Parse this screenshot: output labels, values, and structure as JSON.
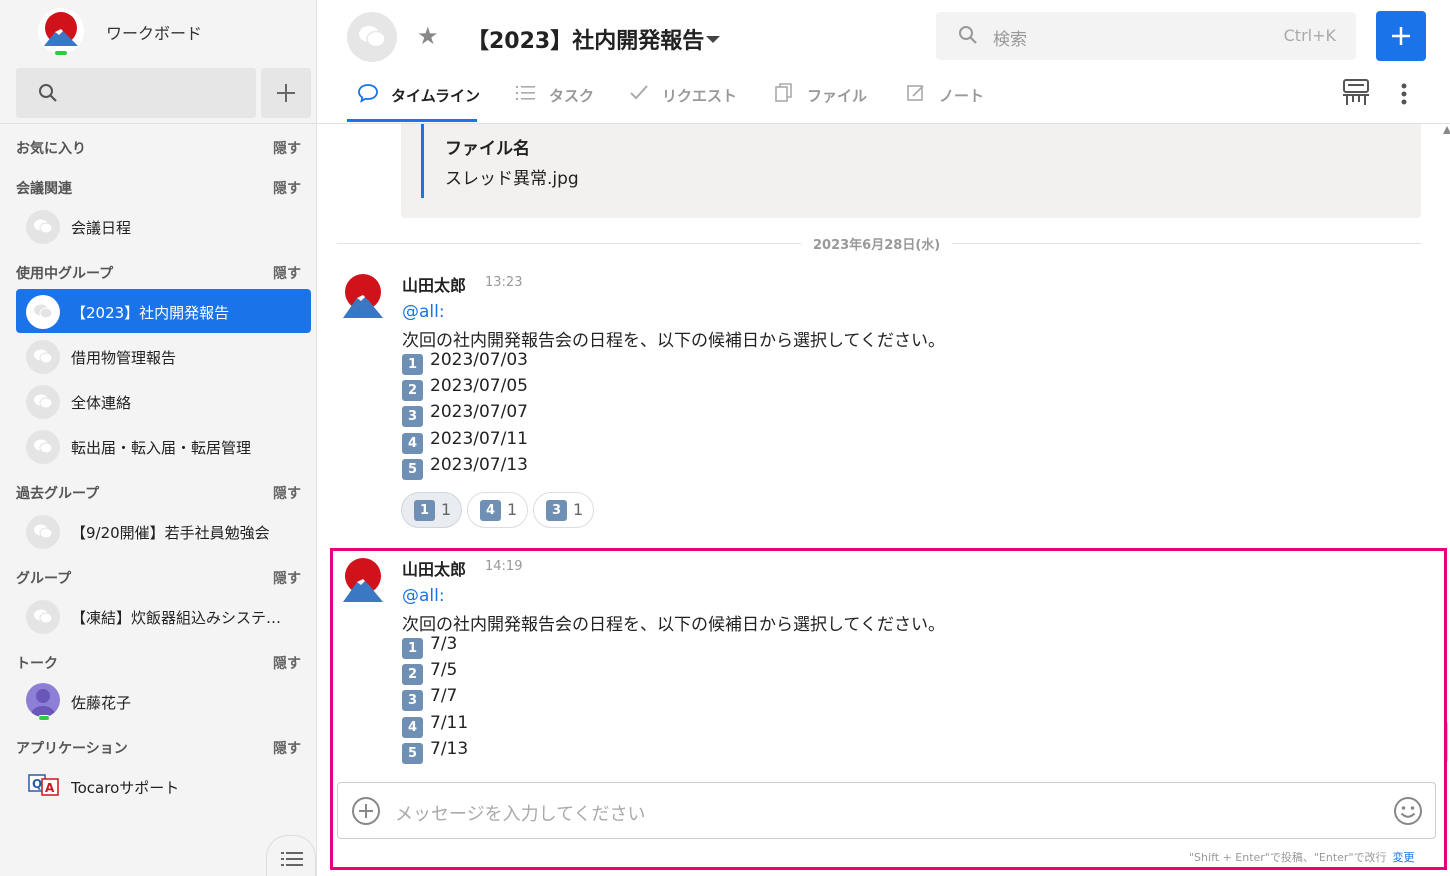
{
  "sidebar": {
    "workspace_name": "ワークボード",
    "sections": [
      {
        "title": "お気に入り",
        "hide": "隠す"
      },
      {
        "title": "会議関連",
        "hide": "隠す"
      },
      {
        "title": "使用中グループ",
        "hide": "隠す"
      },
      {
        "title": "過去グループ",
        "hide": "隠す"
      },
      {
        "title": "グループ",
        "hide": "隠す"
      },
      {
        "title": "トーク",
        "hide": "隠す"
      },
      {
        "title": "アプリケーション",
        "hide": "隠す"
      }
    ],
    "items": {
      "meeting_schedule": "会議日程",
      "dev_report": "【2023】社内開発報告",
      "loan_report": "借用物管理報告",
      "all_contact": "全体連絡",
      "moving_mgmt": "転出届・転入届・転居管理",
      "study_meeting": "【9/20開催】若手社員勉強会",
      "frozen_group": "【凍結】炊飯器組込みシステ…",
      "talk_user": "佐藤花子",
      "tocaro_support": "Tocaroサポート"
    }
  },
  "header": {
    "title": "【2023】社内開発報告",
    "search_placeholder": "検索",
    "search_shortcut": "Ctrl+K",
    "tabs": [
      {
        "label": "タイムライン",
        "icon": "chat-bubble-icon",
        "active": true
      },
      {
        "label": "タスク",
        "icon": "list-icon",
        "active": false
      },
      {
        "label": "リクエスト",
        "icon": "check-icon",
        "active": false
      },
      {
        "label": "ファイル",
        "icon": "file-copy-icon",
        "active": false
      },
      {
        "label": "ノート",
        "icon": "edit-note-icon",
        "active": false
      }
    ]
  },
  "timeline": {
    "file_block": {
      "key": "ファイル名",
      "value": "スレッド異常.jpg"
    },
    "date_separator": "2023年6月28日(水)",
    "messages": [
      {
        "author": "山田太郎",
        "time": "13:23",
        "mention": "@all:",
        "body": "次回の社内開発報告会の日程を、以下の候補日から選択してください。",
        "options": [
          {
            "num": "1",
            "text": "2023/07/03"
          },
          {
            "num": "2",
            "text": "2023/07/05"
          },
          {
            "num": "3",
            "text": "2023/07/07"
          },
          {
            "num": "4",
            "text": "2023/07/11"
          },
          {
            "num": "5",
            "text": "2023/07/13"
          }
        ],
        "reactions": [
          {
            "num": "1",
            "count": "1"
          },
          {
            "num": "4",
            "count": "1"
          },
          {
            "num": "3",
            "count": "1"
          }
        ]
      },
      {
        "author": "山田太郎",
        "time": "14:19",
        "mention": "@all:",
        "body": "次回の社内開発報告会の日程を、以下の候補日から選択してください。",
        "options": [
          {
            "num": "1",
            "text": "7/3"
          },
          {
            "num": "2",
            "text": "7/5"
          },
          {
            "num": "3",
            "text": "7/7"
          },
          {
            "num": "4",
            "text": "7/11"
          },
          {
            "num": "5",
            "text": "7/13"
          }
        ]
      }
    ]
  },
  "composer": {
    "placeholder": "メッセージを入力してください",
    "hint": "\"Shift + Enter\"で投稿、\"Enter\"で改行",
    "change_label": "変更"
  },
  "colors": {
    "accent": "#1a73e8",
    "highlight_border": "#e6007e",
    "number_badge": "#6f8fb4"
  }
}
